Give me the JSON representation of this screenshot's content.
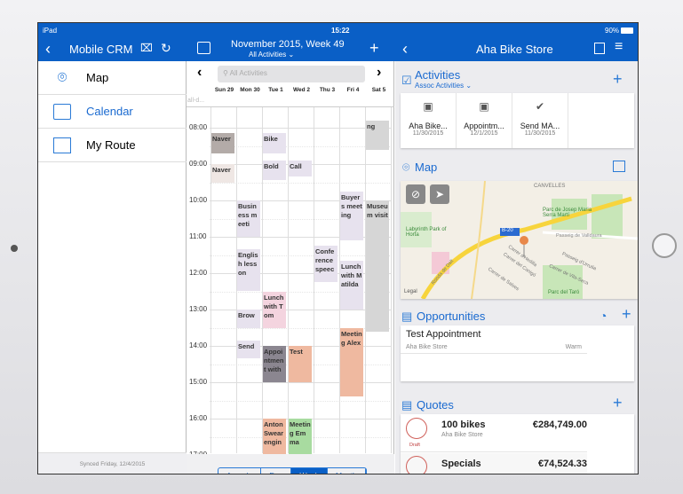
{
  "status": {
    "device": "iPad",
    "time": "15:22",
    "battery": "90%"
  },
  "left": {
    "title": "Mobile CRM",
    "items": [
      {
        "label": "Map"
      },
      {
        "label": "Calendar"
      },
      {
        "label": "My Route"
      }
    ],
    "sync": "Synced Friday, 12/4/2015"
  },
  "calendar": {
    "title": "November 2015, Week 49",
    "filter": "All Activities",
    "search_placeholder": "All Activities",
    "allday": "all-d...",
    "days": [
      "Sun 29",
      "Mon 30",
      "Tue 1",
      "Wed 2",
      "Thu 3",
      "Fri 4",
      "Sat 5"
    ],
    "hours": [
      "08:00",
      "09:00",
      "10:00",
      "11:00",
      "12:00",
      "13:00",
      "14:00",
      "15:00",
      "16:00",
      "17:00"
    ],
    "events": [
      {
        "day": 0,
        "start": 8.15,
        "end": 8.7,
        "title": "Naver",
        "color": "#b3aba8"
      },
      {
        "day": 0,
        "start": 9.0,
        "end": 9.5,
        "title": "Naver",
        "color": "#efe7e4"
      },
      {
        "day": 1,
        "start": 10.0,
        "end": 11.0,
        "title": "Business meeti",
        "color": "#e7e2ee"
      },
      {
        "day": 1,
        "start": 11.35,
        "end": 12.5,
        "title": "English lesson",
        "color": "#e7e2ee"
      },
      {
        "day": 1,
        "start": 13.0,
        "end": 13.5,
        "title": "Brow",
        "color": "#e7e2ee"
      },
      {
        "day": 1,
        "start": 13.85,
        "end": 14.35,
        "title": "Send",
        "color": "#e7e2ee"
      },
      {
        "day": 2,
        "start": 8.15,
        "end": 8.7,
        "title": "Bike",
        "color": "#e7e2ee"
      },
      {
        "day": 2,
        "start": 8.9,
        "end": 9.45,
        "title": "Bold",
        "color": "#e7e2ee"
      },
      {
        "day": 2,
        "start": 12.5,
        "end": 13.5,
        "title": "Lunch with Tom",
        "color": "#f4d4df"
      },
      {
        "day": 2,
        "start": 14.0,
        "end": 15.0,
        "title": "Appointment with",
        "color": "#8b8690"
      },
      {
        "day": 2,
        "start": 16.0,
        "end": 17.3,
        "title": "Anton Swearengin",
        "color": "#efb9a0"
      },
      {
        "day": 3,
        "start": 8.9,
        "end": 9.35,
        "title": "Call",
        "color": "#e7e2ee"
      },
      {
        "day": 3,
        "start": 14.0,
        "end": 15.0,
        "title": "Test",
        "color": "#efb9a0"
      },
      {
        "day": 3,
        "start": 16.0,
        "end": 17.0,
        "title": "Meeting Emma",
        "color": "#a8dba0"
      },
      {
        "day": 4,
        "start": 11.25,
        "end": 12.25,
        "title": "Conference speec",
        "color": "#e7e2ee"
      },
      {
        "day": 5,
        "start": 9.75,
        "end": 11.1,
        "title": "Buyers meeting",
        "color": "#e7e2ee"
      },
      {
        "day": 5,
        "start": 11.65,
        "end": 13.0,
        "title": "Lunch with Matilda",
        "color": "#e7e2ee"
      },
      {
        "day": 5,
        "start": 13.5,
        "end": 15.4,
        "title": "Meeting Alex",
        "color": "#efb9a0"
      },
      {
        "day": 6,
        "start": 7.8,
        "end": 8.6,
        "title": "ng",
        "color": "#d6d6d6"
      },
      {
        "day": 6,
        "start": 10.0,
        "end": 13.6,
        "title": "Museum visit",
        "color": "#d6d6d6"
      },
      {
        "day": 6,
        "start": 17.0,
        "end": 17.3,
        "title": "Beer",
        "color": "#d6d6d6"
      }
    ],
    "views": [
      "Agenda",
      "Day",
      "Week",
      "Month"
    ],
    "active_view": "Week"
  },
  "detail": {
    "title": "Aha Bike Store",
    "activities": {
      "title": "Activities",
      "filter": "Assoc Activities",
      "items": [
        {
          "title": "Aha Bike...",
          "date": "11/30/2015",
          "icon": "calendar"
        },
        {
          "title": "Appointm...",
          "date": "12/1/2015",
          "icon": "calendar"
        },
        {
          "title": "Send MA...",
          "date": "11/30/2015",
          "icon": "check"
        }
      ]
    },
    "map": {
      "title": "Map",
      "labels": [
        "CANVELLES",
        "Parc de Josep Maria Serra Martí",
        "Labyrinth Park of Horta",
        "B-20",
        "Passeig de Valldaura",
        "Ronda de Dalt",
        "Carrer d'Hedilla",
        "Carrer del Canigó",
        "Carrer de Salses",
        "Passeig d'Urrutia",
        "Carrer de Vila-Seca",
        "Parc del Taró",
        "Legal"
      ]
    },
    "opportunities": {
      "title": "Opportunities",
      "items": [
        {
          "name": "Test Appointment",
          "account": "Aha Bike Store",
          "status": "Warm"
        }
      ]
    },
    "quotes": {
      "title": "Quotes",
      "items": [
        {
          "name": "100 bikes",
          "account": "Aha Bike Store",
          "amount": "€284,749.00",
          "status": "Draft"
        },
        {
          "name": "Specials",
          "amount": "€74,524.33"
        }
      ]
    }
  }
}
